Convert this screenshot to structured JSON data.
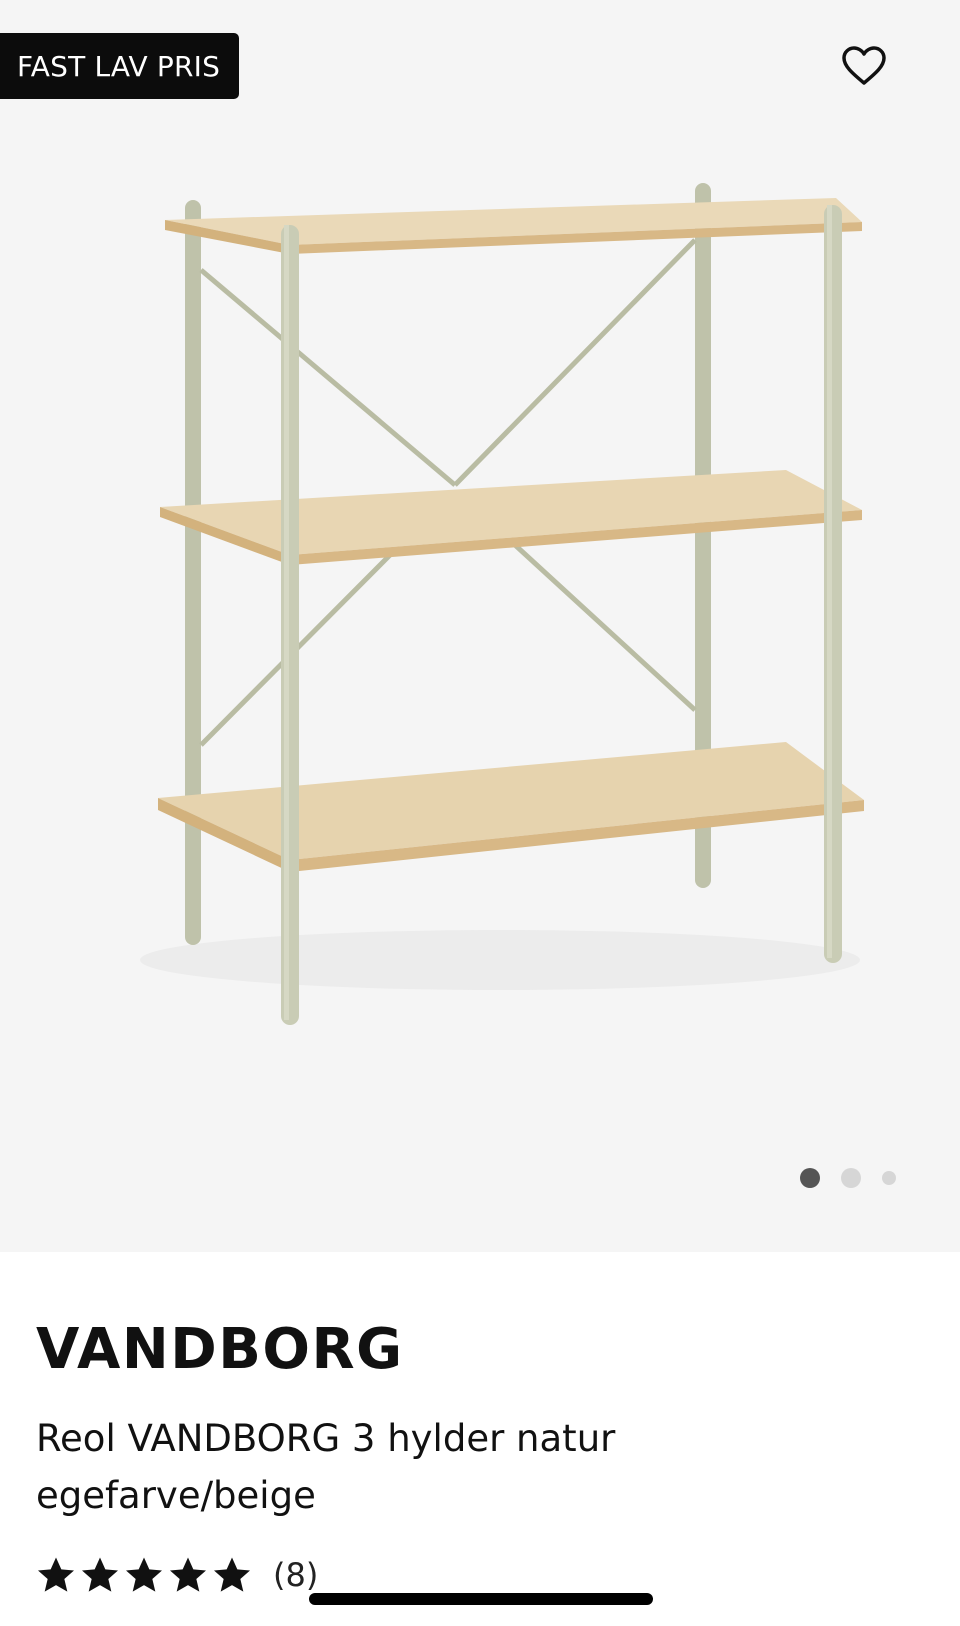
{
  "badge": {
    "label": "FAST LAV PRIS"
  },
  "favorite": {
    "icon": "heart-outline-icon"
  },
  "gallery": {
    "image_alt": "Reol VANDBORG 3 hylder",
    "dots_total": 3,
    "active_index": 0
  },
  "product": {
    "brand": "VANDBORG",
    "title": "Reol VANDBORG 3 hylder natur egefarve/beige",
    "rating": {
      "stars": 5,
      "max": 5,
      "count_label": "(8)"
    }
  },
  "colors": {
    "badge_bg": "#0c0c0c",
    "gallery_bg": "#f5f5f5",
    "shelf_wood": "#e2cfa8",
    "frame_beige": "#c9ccb5"
  }
}
